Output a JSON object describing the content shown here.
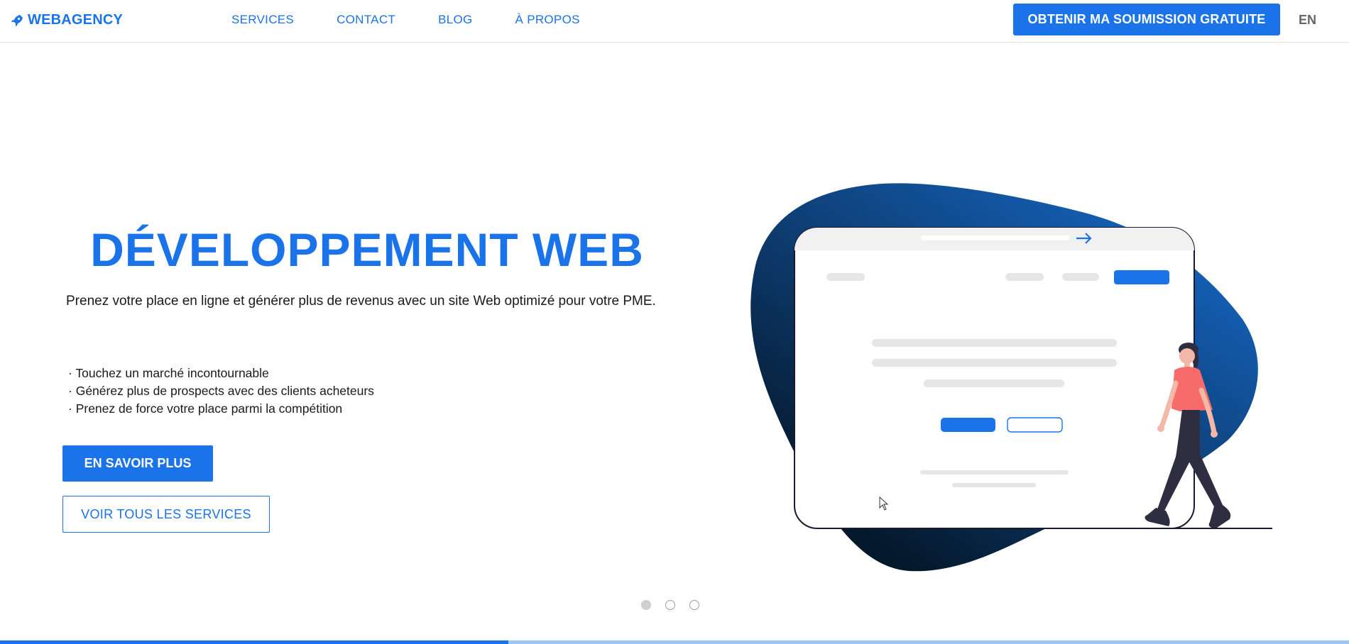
{
  "navbar": {
    "logo_text": "WEBAGENCY",
    "links": [
      {
        "label": "SERVICES"
      },
      {
        "label": "CONTACT"
      },
      {
        "label": "BLOG"
      },
      {
        "label": "À PROPOS"
      }
    ],
    "cta_label": "OBTENIR MA SOUMISSION GRATUITE",
    "lang_label": "EN"
  },
  "hero": {
    "title": "DÉVELOPPEMENT WEB",
    "subtitle": "Prenez votre place en ligne et générer plus de revenus avec un site Web optimizé pour votre PME.",
    "bullets": [
      "Touchez un marché incontournable",
      "Générez plus de prospects avec des clients acheteurs",
      "Prenez de force votre place parmi la compétition"
    ],
    "primary_button": "EN SAVOIR PLUS",
    "secondary_button": "VOIR TOUS LES SERVICES"
  },
  "carousel": {
    "slide_count": 3,
    "active_index": 0,
    "progress_fraction": 0.377
  },
  "colors": {
    "accent": "#1a73e8",
    "blob_dark": "#0a2342",
    "blob_blue": "#1565c0",
    "shirt": "#f76b6b",
    "pants": "#2f2e41"
  },
  "icons": {
    "logo": "rocket-icon",
    "browser_arrow": "arrow-right-icon",
    "cursor": "mouse-cursor-icon"
  }
}
